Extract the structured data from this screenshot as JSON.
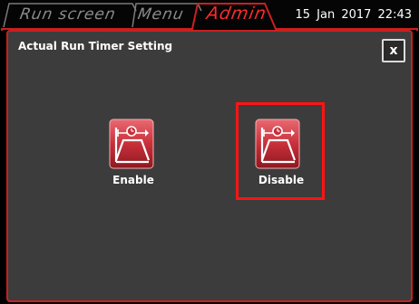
{
  "tabs": [
    {
      "label": "Run screen",
      "active": false
    },
    {
      "label": "Menu",
      "active": false
    },
    {
      "label": "Admin",
      "active": true
    }
  ],
  "datetime": "15  Jan  2017  22:43",
  "panel": {
    "title": "Actual Run Timer Setting",
    "close_label": "x",
    "options": [
      {
        "label": "Enable",
        "icon": "run-timer-icon",
        "selected": false
      },
      {
        "label": "Disable",
        "icon": "run-timer-icon",
        "selected": true
      }
    ]
  },
  "colors": {
    "accent": "#cc1f1f",
    "active_tab_text": "#ff2b2b",
    "panel_bg": "#3c3c3c",
    "icon_bg": "#c8303a"
  }
}
